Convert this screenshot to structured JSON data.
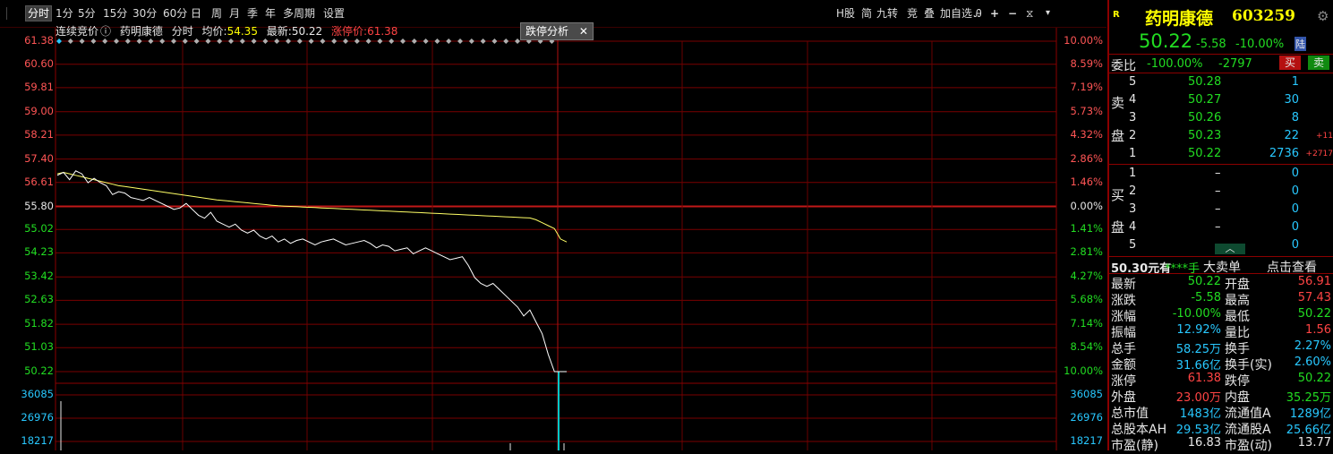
{
  "toolbar": {
    "periods": [
      "分时",
      "1分",
      "5分",
      "15分",
      "30分",
      "60分",
      "日",
      "周",
      "月",
      "季",
      "年",
      "多周期",
      "设置"
    ],
    "active": "分时",
    "right_tools": [
      "H股",
      "简",
      "九转",
      "竞",
      "叠",
      "加自选"
    ]
  },
  "info": {
    "mode": "连续竞价",
    "name": "药明康德",
    "chart_kind": "分时",
    "avg_label": "均价:",
    "avg_value": "54.35",
    "latest_label": "最新:",
    "latest_value": "50.22",
    "limit_label": "涨停价:",
    "limit_value": "61.38",
    "analysis_button": "跌停分析",
    "close_glyph": "✕"
  },
  "chart_data": {
    "type": "line",
    "price_ticks": [
      "61.38",
      "60.60",
      "59.81",
      "59.00",
      "58.21",
      "57.40",
      "56.61",
      "55.80",
      "55.02",
      "54.23",
      "53.42",
      "52.63",
      "51.82",
      "51.03",
      "50.22"
    ],
    "pct_ticks": [
      "10.00%",
      "8.59%",
      "7.19%",
      "5.73%",
      "4.32%",
      "2.86%",
      "1.46%",
      "0.00%",
      "1.41%",
      "2.81%",
      "4.27%",
      "5.68%",
      "7.14%",
      "8.54%",
      "10.00%"
    ],
    "volume_ticks": [
      "36085",
      "26976",
      "18217"
    ],
    "ylim": [
      50.22,
      61.38
    ],
    "prev_close": 55.8,
    "x_minutes_total": 240,
    "series": [
      {
        "color": "#ffffff",
        "values": [
          56.85,
          56.95,
          56.7,
          57.0,
          56.9,
          56.6,
          56.75,
          56.6,
          56.5,
          56.2,
          56.3,
          56.25,
          56.1,
          56.05,
          56.0,
          56.1,
          56.0,
          55.9,
          55.8,
          55.7,
          55.75,
          55.9,
          55.7,
          55.5,
          55.4,
          55.6,
          55.3,
          55.2,
          55.1,
          55.2,
          55.0,
          54.9,
          55.0,
          54.8,
          54.7,
          54.8,
          54.6,
          54.7,
          54.55,
          54.65,
          54.7,
          54.6,
          54.5,
          54.6,
          54.65,
          54.7,
          54.6,
          54.5,
          54.55,
          54.6,
          54.65,
          54.55,
          54.4,
          54.5,
          54.45,
          54.3,
          54.35,
          54.4,
          54.2,
          54.3,
          54.4,
          54.3,
          54.2,
          54.1,
          54.0,
          54.05,
          54.1,
          53.8,
          53.4,
          53.2,
          53.1,
          53.2,
          53.0,
          52.8,
          52.6,
          52.4,
          52.1,
          52.3,
          51.9,
          51.5,
          50.8,
          50.22,
          50.22,
          50.22
        ]
      },
      {
        "color": "#ffff66",
        "values": [
          56.9,
          56.95,
          56.9,
          56.85,
          56.8,
          56.75,
          56.7,
          56.65,
          56.6,
          56.55,
          56.5,
          56.47,
          56.44,
          56.41,
          56.38,
          56.35,
          56.32,
          56.29,
          56.26,
          56.23,
          56.2,
          56.17,
          56.14,
          56.11,
          56.08,
          56.05,
          56.02,
          56.0,
          55.98,
          55.96,
          55.94,
          55.92,
          55.9,
          55.88,
          55.86,
          55.84,
          55.82,
          55.81,
          55.8,
          55.79,
          55.78,
          55.77,
          55.76,
          55.75,
          55.74,
          55.73,
          55.72,
          55.71,
          55.7,
          55.69,
          55.68,
          55.67,
          55.66,
          55.65,
          55.64,
          55.63,
          55.62,
          55.61,
          55.6,
          55.59,
          55.58,
          55.57,
          55.56,
          55.55,
          55.54,
          55.53,
          55.52,
          55.51,
          55.5,
          55.49,
          55.48,
          55.47,
          55.46,
          55.45,
          55.44,
          55.43,
          55.42,
          55.41,
          55.35,
          55.25,
          55.15,
          55.05,
          54.7,
          54.6
        ]
      }
    ]
  },
  "panel": {
    "flag": "R",
    "stock_name": "药明康德",
    "stock_code": "603259",
    "price": "50.22",
    "change": "-5.58",
    "change_pct": "-10.00%",
    "board_tag": "陆",
    "weibi_label": "委比",
    "weibi_value": "-100.00%",
    "weicha_value": "-2797",
    "buy_btn": "买",
    "sell_btn": "卖",
    "sell_side_label_1": "卖",
    "sell_side_label_2": "盘",
    "buy_side_label_1": "买",
    "buy_side_label_2": "盘",
    "asks": [
      {
        "lvl": "5",
        "price": "50.28",
        "vol": "1",
        "chg": ""
      },
      {
        "lvl": "4",
        "price": "50.27",
        "vol": "30",
        "chg": ""
      },
      {
        "lvl": "3",
        "price": "50.26",
        "vol": "8",
        "chg": ""
      },
      {
        "lvl": "2",
        "price": "50.23",
        "vol": "22",
        "chg": "+11"
      },
      {
        "lvl": "1",
        "price": "50.22",
        "vol": "2736",
        "chg": "+2717"
      }
    ],
    "bids": [
      {
        "lvl": "1",
        "price": "–",
        "vol": "0"
      },
      {
        "lvl": "2",
        "price": "–",
        "vol": "0"
      },
      {
        "lvl": "3",
        "price": "–",
        "vol": "0"
      },
      {
        "lvl": "4",
        "price": "–",
        "vol": "0"
      },
      {
        "lvl": "5",
        "price": "–",
        "vol": "0"
      }
    ],
    "bigorder": {
      "price": "50.30元有",
      "qty": "****手",
      "label": "大卖单",
      "action": "点击查看"
    },
    "stats": [
      [
        "最新",
        "50.22",
        "grn",
        "开盘",
        "56.91",
        "red"
      ],
      [
        "涨跌",
        "-5.58",
        "grn",
        "最高",
        "57.43",
        "red"
      ],
      [
        "涨幅",
        "-10.00%",
        "grn",
        "最低",
        "50.22",
        "grn"
      ],
      [
        "振幅",
        "12.92%",
        "cyn",
        "量比",
        "1.56",
        "red"
      ],
      [
        "总手",
        "58.25万",
        "cyn",
        "换手",
        "2.27%",
        "cyn"
      ],
      [
        "金额",
        "31.66亿",
        "cyn",
        "换手(实)",
        "2.60%",
        "cyn"
      ],
      [
        "涨停",
        "61.38",
        "red",
        "跌停",
        "50.22",
        "grn"
      ],
      [
        "外盘",
        "23.00万",
        "red",
        "内盘",
        "35.25万",
        "grn"
      ],
      [
        "总市值",
        "1483亿",
        "cyn",
        "流通值A",
        "1289亿",
        "cyn"
      ],
      [
        "总股本AH",
        "29.53亿",
        "cyn",
        "流通股A",
        "25.66亿",
        "cyn"
      ],
      [
        "市盈(静)",
        "16.83",
        "wht",
        "市盈(动)",
        "13.77",
        "wht"
      ]
    ]
  }
}
